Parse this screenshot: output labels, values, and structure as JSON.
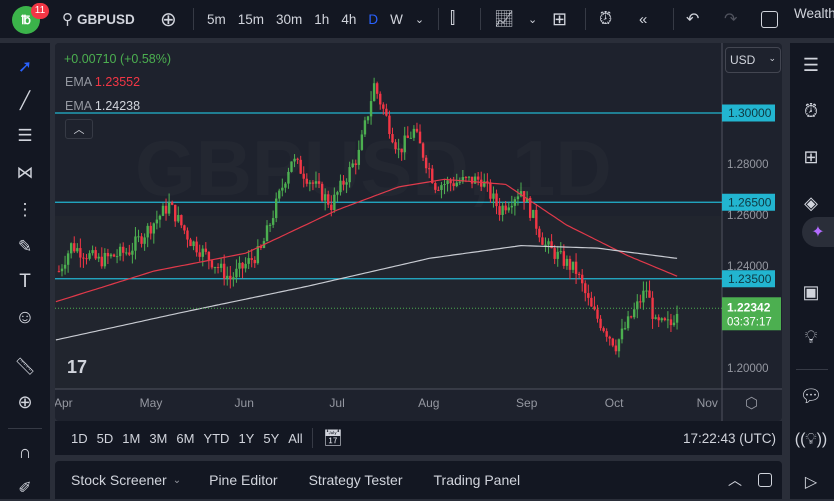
{
  "header": {
    "notifications": "11",
    "symbol": "GBPUSD",
    "intervals": [
      "5m",
      "15m",
      "30m",
      "1h",
      "4h",
      "D",
      "W"
    ],
    "active_interval": "D",
    "account": "Wealth"
  },
  "legend": {
    "change": "+0.00710 (+0.58%)",
    "ema1_label": "EMA",
    "ema1_value": "1.23552",
    "ema2_label": "EMA",
    "ema2_value": "1.24238"
  },
  "watermark": "GBPUSD, 1D",
  "currency": "USD",
  "colors": {
    "up": "#4caf50",
    "down": "#f23645",
    "ema_fast": "#e0394a",
    "ema_slow": "#c8cbd2",
    "level": "#22b5d0",
    "accent": "#2962ff"
  },
  "chart_data": {
    "type": "candlestick",
    "symbol": "GBPUSD",
    "ylim": [
      1.195,
      1.3195
    ],
    "price_ticks": [
      "1.28000",
      "1.26000",
      "1.24000",
      "1.20000"
    ],
    "price_tick_values": [
      1.28,
      1.26,
      1.24,
      1.2
    ],
    "levels": [
      {
        "value": 1.3,
        "label": "1.30000"
      },
      {
        "value": 1.265,
        "label": "1.26500"
      },
      {
        "value": 1.235,
        "label": "1.23500"
      }
    ],
    "last_price": {
      "value": 1.22342,
      "label": "1.22342",
      "countdown": "03:37:17"
    },
    "months": [
      {
        "label": "Apr",
        "day": 0
      },
      {
        "label": "May",
        "day": 28
      },
      {
        "label": "Jun",
        "day": 59
      },
      {
        "label": "Jul",
        "day": 90
      },
      {
        "label": "Aug",
        "day": 119
      },
      {
        "label": "Sep",
        "day": 151
      },
      {
        "label": "Oct",
        "day": 180
      },
      {
        "label": "Nov",
        "day": 210
      }
    ],
    "price_path": [
      [
        -1,
        1.238
      ],
      [
        3,
        1.248
      ],
      [
        12,
        1.242
      ],
      [
        22,
        1.246
      ],
      [
        35,
        1.264
      ],
      [
        42,
        1.25
      ],
      [
        55,
        1.235
      ],
      [
        65,
        1.246
      ],
      [
        75,
        1.282
      ],
      [
        88,
        1.264
      ],
      [
        97,
        1.284
      ],
      [
        102,
        1.311
      ],
      [
        110,
        1.285
      ],
      [
        115,
        1.293
      ],
      [
        122,
        1.272
      ],
      [
        137,
        1.274
      ],
      [
        143,
        1.262
      ],
      [
        150,
        1.27
      ],
      [
        158,
        1.248
      ],
      [
        168,
        1.238
      ],
      [
        173,
        1.223
      ],
      [
        181,
        1.209
      ],
      [
        191,
        1.231
      ],
      [
        194,
        1.217
      ],
      [
        199,
        1.217
      ],
      [
        201,
        1.2234
      ]
    ],
    "ema_fast": [
      [
        -2,
        1.226
      ],
      [
        30,
        1.238
      ],
      [
        60,
        1.245
      ],
      [
        90,
        1.262
      ],
      [
        110,
        1.271
      ],
      [
        125,
        1.274
      ],
      [
        145,
        1.272
      ],
      [
        165,
        1.256
      ],
      [
        185,
        1.244
      ],
      [
        201,
        1.236
      ]
    ],
    "ema_slow": [
      [
        -2,
        1.211
      ],
      [
        40,
        1.222
      ],
      [
        80,
        1.232
      ],
      [
        120,
        1.243
      ],
      [
        150,
        1.248
      ],
      [
        175,
        1.247
      ],
      [
        201,
        1.243
      ]
    ]
  },
  "range_buttons": [
    "1D",
    "5D",
    "1M",
    "3M",
    "6M",
    "YTD",
    "1Y",
    "5Y",
    "All"
  ],
  "clock": "17:22:43 (UTC)",
  "panels": [
    "Stock Screener",
    "Pine Editor",
    "Strategy Tester",
    "Trading Panel"
  ]
}
